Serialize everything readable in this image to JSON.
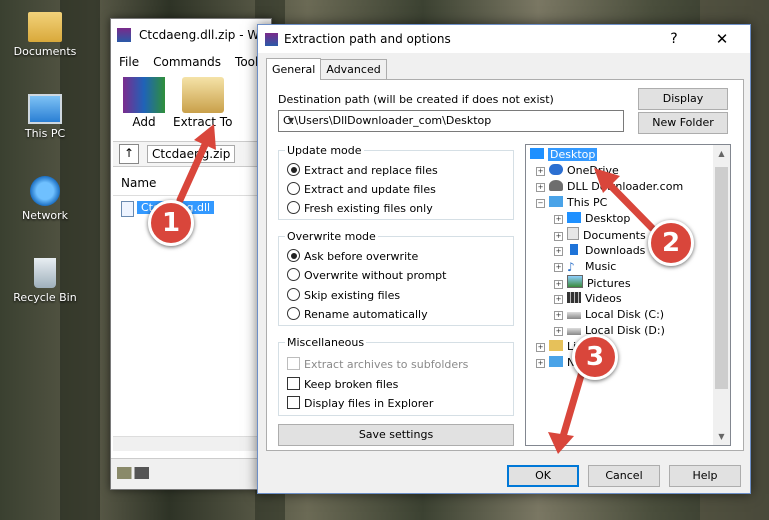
{
  "desktop": {
    "icons": [
      {
        "label": "Documents",
        "icon": "folder-icon"
      },
      {
        "label": "This PC",
        "icon": "computer-icon"
      },
      {
        "label": "Network",
        "icon": "network-icon"
      },
      {
        "label": "Recycle Bin",
        "icon": "recycle-bin-icon"
      }
    ]
  },
  "winrar": {
    "title": "Ctcdaeng.dll.zip - W",
    "menu": [
      "File",
      "Commands",
      "Tools"
    ],
    "tools": [
      {
        "label": "Add",
        "icon": "add-archive-icon"
      },
      {
        "label": "Extract To",
        "icon": "extract-to-icon"
      }
    ],
    "path": "Ctcdaeng.zip",
    "column_name": "Name",
    "file": "Ctcdaeng.dll"
  },
  "dialog": {
    "title": "Extraction path and options",
    "help": "?",
    "close": "✕",
    "tabs": [
      "General",
      "Advanced"
    ],
    "dest_label": "Destination path (will be created if does not exist)",
    "dest_value": "C:\\Users\\DllDownloader_com\\Desktop",
    "btn_display": "Display",
    "btn_new_folder": "New Folder",
    "update_mode": {
      "title": "Update mode",
      "options": [
        "Extract and replace files",
        "Extract and update files",
        "Fresh existing files only"
      ],
      "selected": 0
    },
    "overwrite_mode": {
      "title": "Overwrite mode",
      "options": [
        "Ask before overwrite",
        "Overwrite without prompt",
        "Skip existing files",
        "Rename automatically"
      ],
      "selected": 0
    },
    "misc": {
      "title": "Miscellaneous",
      "options": [
        "Extract archives to subfolders",
        "Keep broken files",
        "Display files in Explorer"
      ]
    },
    "btn_save": "Save settings",
    "tree": [
      "Desktop",
      "OneDrive",
      "DLL Downloader.com",
      "This PC",
      "Desktop",
      "Documents",
      "Downloads",
      "Music",
      "Pictures",
      "Videos",
      "Local Disk (C:)",
      "Local Disk (D:)",
      "Li",
      "N"
    ],
    "btn_ok": "OK",
    "btn_cancel": "Cancel",
    "btn_help": "Help"
  },
  "annotations": [
    "1",
    "2",
    "3"
  ],
  "colors": {
    "accent": "#0078d7",
    "selection": "#3399ff",
    "badge": "#d9463b"
  }
}
